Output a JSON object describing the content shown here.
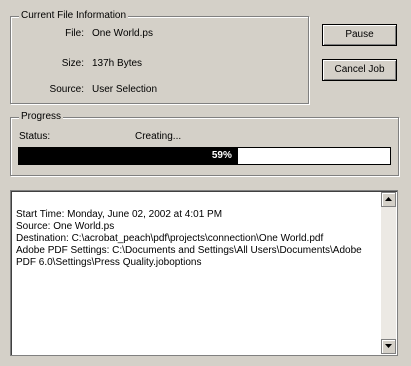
{
  "file_info": {
    "legend": "Current File Information",
    "file_label": "File:",
    "file_value": "One World.ps",
    "size_label": "Size:",
    "size_value": "137h Bytes",
    "source_label": "Source:",
    "source_value": "User Selection"
  },
  "buttons": {
    "pause": "Pause",
    "cancel": "Cancel Job"
  },
  "progress": {
    "legend": "Progress",
    "status_label": "Status:",
    "status_value": "Creating...",
    "percent": 59,
    "percent_label": "59%"
  },
  "log": {
    "text": "Start Time: Monday, June 02, 2002 at 4:01 PM\nSource: One World.ps\nDestination: C:\\acrobat_peach\\pdf\\projects\\connection\\One World.pdf\nAdobe PDF Settings: C:\\Documents and Settings\\All Users\\Documents\\Adobe PDF 6.0\\Settings\\Press Quality.joboptions"
  },
  "icons": {
    "scroll_up": "triangle-up",
    "scroll_down": "triangle-down"
  }
}
